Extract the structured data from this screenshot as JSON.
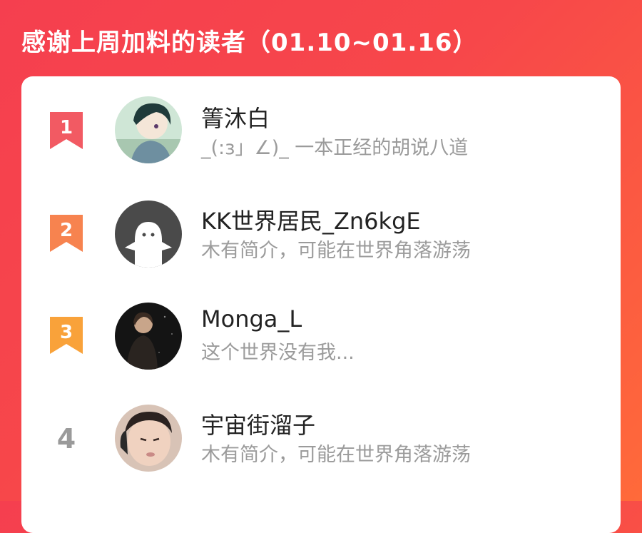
{
  "header": {
    "title": "感谢上周加料的读者（01.10~01.16）"
  },
  "colors": {
    "background_start": "#f53f4f",
    "background_end": "#ff6a3a",
    "rank1": "#f25a63",
    "rank2": "#f7834f",
    "rank3": "#f9a23a",
    "rank_plain": "#9a9a9a"
  },
  "readers": [
    {
      "rank": "1",
      "name": "箐沐白",
      "bio": "_(:з」∠)_ 一本正经的胡说八道",
      "avatar": "anime-boy-avatar"
    },
    {
      "rank": "2",
      "name": "KK世界居民_Zn6kgE",
      "bio": "木有简介，可能在世界角落游荡",
      "avatar": "default-ghost-avatar"
    },
    {
      "rank": "3",
      "name": "Monga_L",
      "bio": "这个世界没有我...",
      "avatar": "dark-portrait-avatar"
    },
    {
      "rank": "4",
      "name": "宇宙街溜子",
      "bio": "木有简介，可能在世界角落游荡",
      "avatar": "face-photo-avatar"
    }
  ]
}
